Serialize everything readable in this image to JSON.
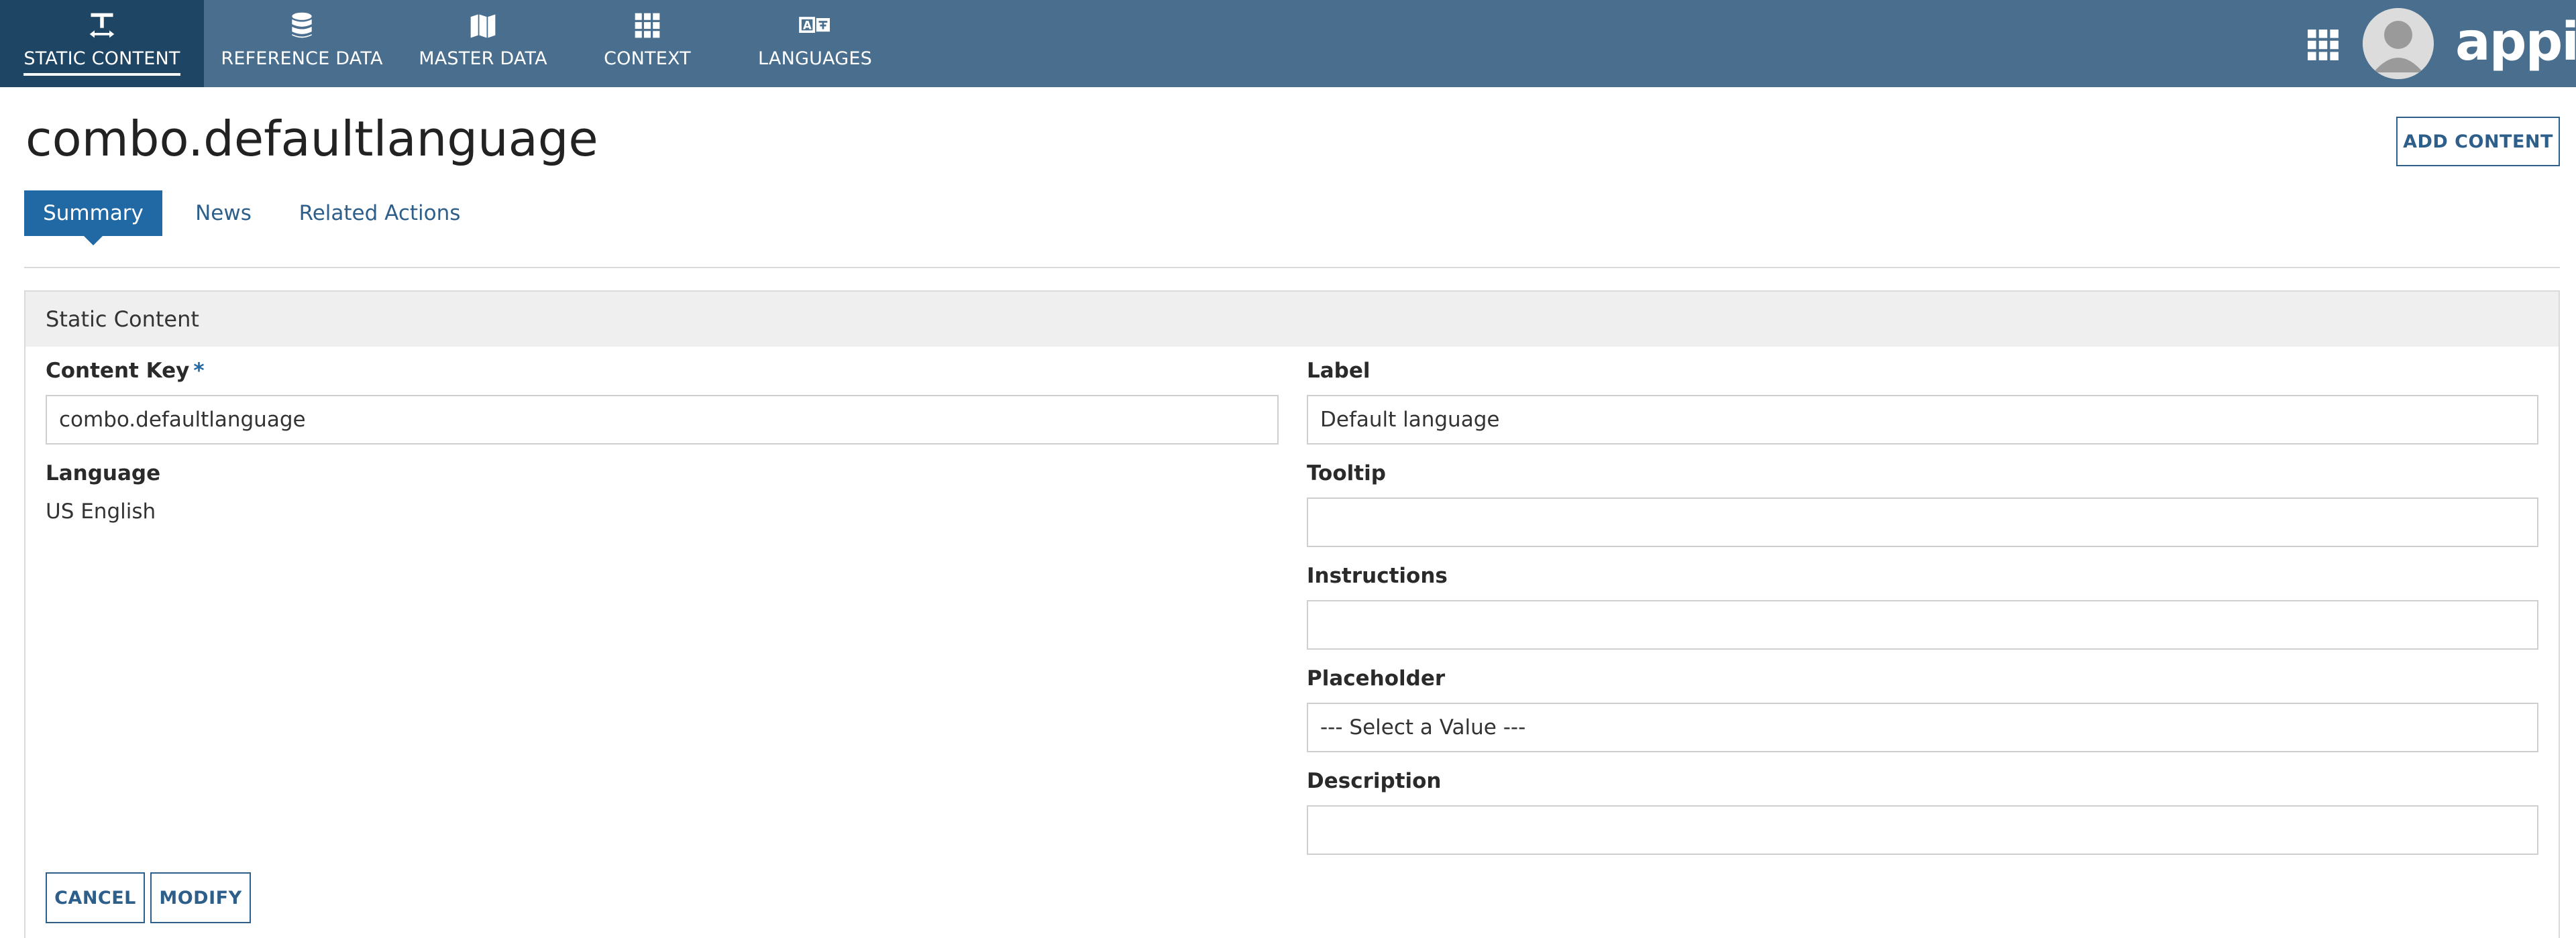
{
  "colors": {
    "topbar": "#4a6f8e",
    "topbar_active": "#1e4563",
    "accent": "#2169a5",
    "button_text": "#2e5f8a",
    "section_header_bg": "#efefef"
  },
  "nav": {
    "items": [
      {
        "label": "STATIC CONTENT",
        "icon": "text-format-icon",
        "active": true
      },
      {
        "label": "REFERENCE DATA",
        "icon": "database-icon",
        "active": false
      },
      {
        "label": "MASTER DATA",
        "icon": "map-icon",
        "active": false
      },
      {
        "label": "CONTEXT",
        "icon": "grid-icon",
        "active": false
      },
      {
        "label": "LANGUAGES",
        "icon": "translate-icon",
        "active": false
      }
    ],
    "apps_icon": "apps-grid-icon",
    "logo_text": "appian"
  },
  "page": {
    "title": "combo.defaultlanguage",
    "add_content_label": "ADD CONTENT"
  },
  "tabs": [
    {
      "label": "Summary",
      "active": true
    },
    {
      "label": "News",
      "active": false
    },
    {
      "label": "Related Actions",
      "active": false
    }
  ],
  "section": {
    "title": "Static Content",
    "content_key": {
      "label": "Content Key",
      "required_mark": "*",
      "value": "combo.defaultlanguage"
    },
    "language": {
      "label": "Language",
      "value": "US English"
    },
    "label_field": {
      "label": "Label",
      "value": "Default language"
    },
    "tooltip": {
      "label": "Tooltip",
      "value": ""
    },
    "instructions": {
      "label": "Instructions",
      "value": ""
    },
    "placeholder": {
      "label": "Placeholder",
      "value": "--- Select a Value ---"
    },
    "description": {
      "label": "Description",
      "value": ""
    }
  },
  "actions": {
    "cancel_label": "CANCEL",
    "modify_label": "MODIFY"
  }
}
